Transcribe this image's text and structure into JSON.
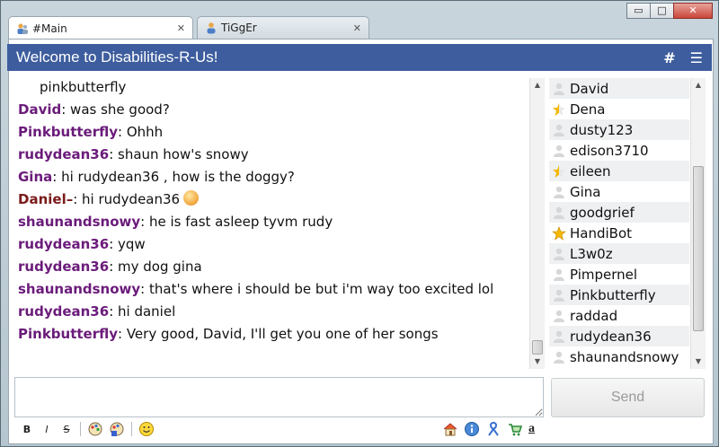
{
  "window": {
    "controls": {
      "minimize": "▭",
      "maximize": "□",
      "close": "✕"
    }
  },
  "tabs": [
    {
      "label": "#Main",
      "close": "✕",
      "active": true
    },
    {
      "label": "TiGgEr",
      "close": "✕",
      "active": false
    }
  ],
  "header": {
    "title": "Welcome to Disabilities-R-Us!",
    "hash_icon": "#",
    "menu_icon": "☰"
  },
  "chat": {
    "messages": [
      {
        "nick": "",
        "text": "pinkbutterfly",
        "continuation": true
      },
      {
        "nick": "David",
        "text": ": was she good?"
      },
      {
        "nick": "Pinkbutterfly",
        "text": ": Ohhh"
      },
      {
        "nick": "rudydean36",
        "text": ":  shaun  how's snowy"
      },
      {
        "nick": "Gina",
        "text": ": hi rudydean36 , how is the doggy?"
      },
      {
        "nick": "Daniel–",
        "text": ": hi rudydean36",
        "smiley": true
      },
      {
        "nick": "shaunandsnowy",
        "text": ": he is fast asleep tyvm rudy"
      },
      {
        "nick": "rudydean36",
        "text": ": yqw"
      },
      {
        "nick": "rudydean36",
        "text": ": my dog gina"
      },
      {
        "nick": "shaunandsnowy",
        "text": ": that's where i should be but i'm way too excited lol"
      },
      {
        "nick": "rudydean36",
        "text": ": hi daniel"
      },
      {
        "nick": "Pinkbutterfly",
        "text": ": Very good, David, I'll get you one of her songs"
      }
    ]
  },
  "users": [
    {
      "name": "David",
      "icon": "user-icon"
    },
    {
      "name": "Dena",
      "icon": "half-star-icon"
    },
    {
      "name": "dusty123",
      "icon": "user-icon"
    },
    {
      "name": "edison3710",
      "icon": "user-icon"
    },
    {
      "name": "eileen",
      "icon": "half-star-icon"
    },
    {
      "name": "Gina",
      "icon": "user-icon"
    },
    {
      "name": "goodgrief",
      "icon": "user-icon"
    },
    {
      "name": "HandiBot",
      "icon": "star-icon"
    },
    {
      "name": "L3w0z",
      "icon": "user-icon"
    },
    {
      "name": "Pimpernel",
      "icon": "user-icon"
    },
    {
      "name": "Pinkbutterfly",
      "icon": "user-icon"
    },
    {
      "name": "raddad",
      "icon": "user-icon"
    },
    {
      "name": "rudydean36",
      "icon": "user-icon"
    },
    {
      "name": "shaunandsnowy",
      "icon": "user-icon"
    }
  ],
  "input": {
    "value": "",
    "placeholder": ""
  },
  "send_label": "Send",
  "toolbar": {
    "bold": "B",
    "italic": "I",
    "strike": "S",
    "amazon": "a"
  }
}
